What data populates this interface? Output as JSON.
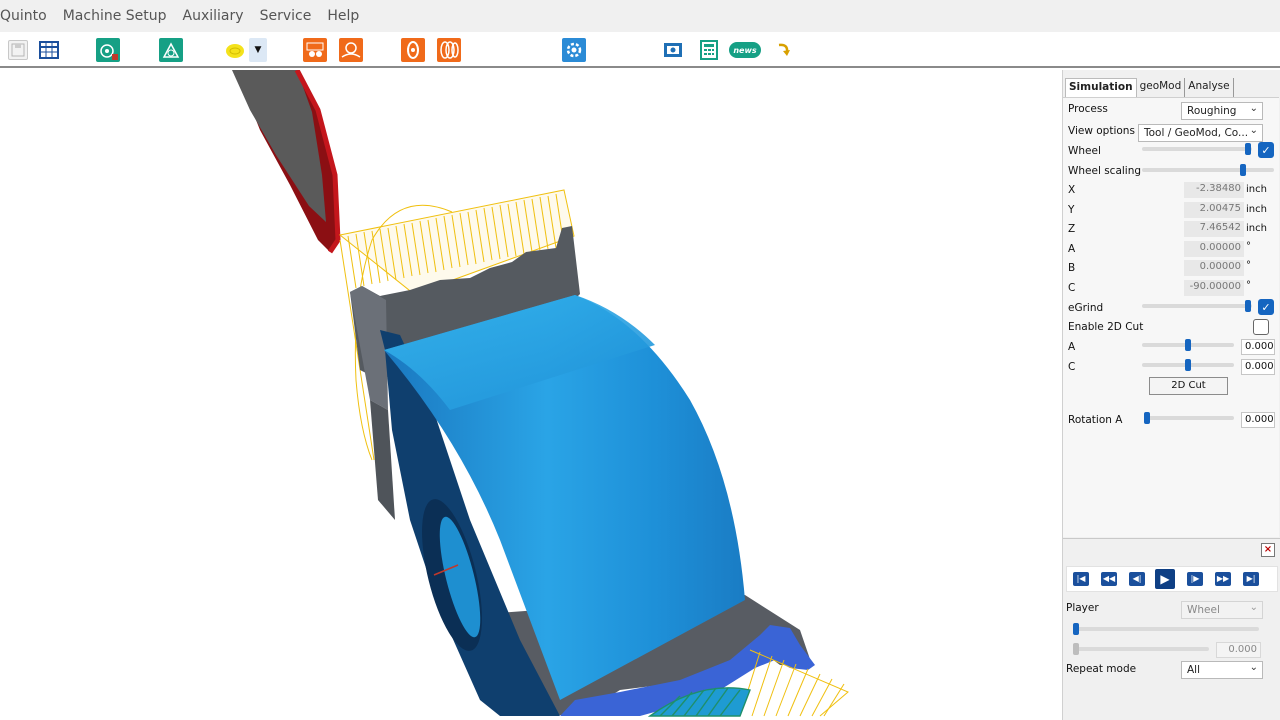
{
  "menu": [
    "Quinto",
    "Machine Setup",
    "Auxiliary",
    "Service",
    "Help"
  ],
  "toolbar": {
    "icons": [
      "save-icon",
      "table-icon",
      "wheel-setup-icon",
      "measure-icon",
      "coolant-icon",
      "dropdown-arrow-icon",
      "grind-icon",
      "grind-path-icon",
      "wheel-icon",
      "wheel-stack-icon",
      "settings-icon",
      "manual-icon",
      "calculator-icon",
      "news-icon",
      "refresh-icon"
    ],
    "news_label": "news",
    "dropdown_glyph": "▼",
    "colors": {
      "teal": "#16a085",
      "orange": "#f06a1a",
      "blue": "#2b8bd6",
      "yellow": "#f4e21b"
    }
  },
  "tabs": [
    "Simulation",
    "geoMod",
    "Analyse"
  ],
  "simulation": {
    "process_label": "Process",
    "process_value": "Roughing",
    "view_label": "View options",
    "view_value": "Tool / GeoMod, Co...",
    "wheel_label": "Wheel",
    "wheel_checked": true,
    "wheel_scaling_label": "Wheel scaling",
    "coords": [
      {
        "label": "X",
        "value": "-2.38480",
        "unit": "inch"
      },
      {
        "label": "Y",
        "value": "2.00475",
        "unit": "inch"
      },
      {
        "label": "Z",
        "value": "7.46542",
        "unit": "inch"
      },
      {
        "label": "A",
        "value": "0.00000",
        "unit": "°"
      },
      {
        "label": "B",
        "value": "0.00000",
        "unit": "°"
      },
      {
        "label": "C",
        "value": "-90.00000",
        "unit": "°"
      }
    ],
    "egrind_label": "eGrind",
    "egrind_checked": true,
    "enable2d_label": "Enable 2D Cut",
    "enable2d_checked": false,
    "a_label": "A",
    "a_value": "0.000",
    "c_label": "C",
    "c_value": "0.000",
    "cut2d_button": "2D Cut",
    "rotation_label": "Rotation A",
    "rotation_value": "0.000",
    "check_glyph": "✓"
  },
  "player": {
    "close": "×",
    "controls": [
      "first-icon",
      "rewind-icon",
      "step-back-icon",
      "play-icon",
      "step-forward-icon",
      "fast-forward-icon",
      "last-icon"
    ],
    "glyphs": [
      "|◀",
      "◀◀",
      "◀|",
      "▶",
      "|▶",
      "▶▶",
      "▶|"
    ],
    "player_label": "Player",
    "player_value": "Wheel",
    "position_value": "0.000",
    "repeat_label": "Repeat mode",
    "repeat_value": "All"
  }
}
